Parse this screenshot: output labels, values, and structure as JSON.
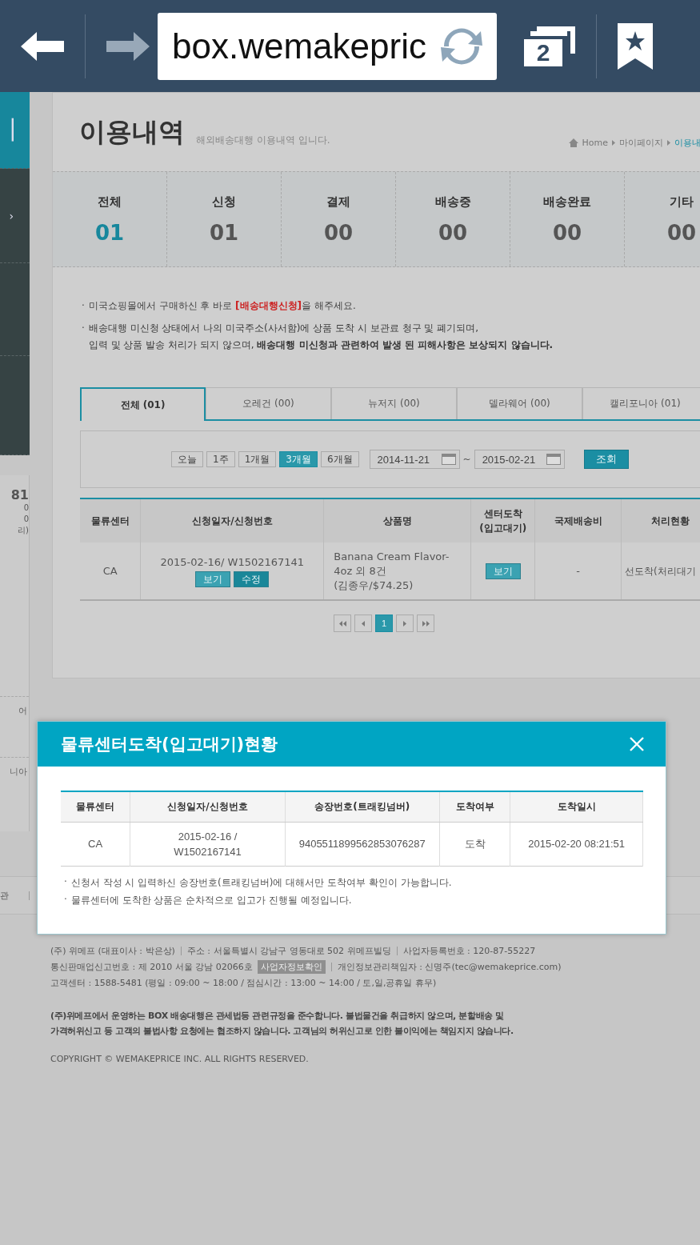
{
  "browser": {
    "url": "box.wemakepric",
    "tab_count": "2"
  },
  "sidebar": {
    "menu": [
      {
        "label": "ㅣ",
        "selected": true
      },
      {
        "label": "›",
        "selected": false
      },
      {
        "selected": false
      },
      {
        "selected": false
      }
    ],
    "fragments": [
      "81",
      "0",
      "0",
      "리)"
    ],
    "lower_fragments": [
      "어",
      "니아"
    ],
    "footer_fragment": "관"
  },
  "header": {
    "title": "이용내역",
    "subtitle": "해외배송대행 이용내역 입니다.",
    "breadcrumb": [
      {
        "label": "Home",
        "current": false
      },
      {
        "label": "마이페이지",
        "current": false
      },
      {
        "label": "이용내",
        "current": true
      }
    ]
  },
  "stats": [
    {
      "label": "전체",
      "value": "01",
      "selected": true
    },
    {
      "label": "신청",
      "value": "01",
      "selected": false
    },
    {
      "label": "결제",
      "value": "00",
      "selected": false
    },
    {
      "label": "배송중",
      "value": "00",
      "selected": false
    },
    {
      "label": "배송완료",
      "value": "00",
      "selected": false
    },
    {
      "label": "기타",
      "value": "00",
      "selected": false
    }
  ],
  "notices": [
    {
      "bullet": "·",
      "text": "미국쇼핑몰에서 구매하신 후 바로 **[배송대행신청]**을 해주세요.",
      "highlighted": true
    },
    {
      "bullet": "·",
      "text": "배송대행 미신청 상태에서 나의 미국주소(사서함)에 상품 도착 시 보관료 청구 및 폐기되며,\n입력 및 상품 발송 처리가 되지 않으며, **배송대행 미신청과 관련하여 발생 된 피해사항은 보상되지 않습니다.**",
      "highlighted": false
    }
  ],
  "region_tabs": [
    {
      "label": "전체 (01)",
      "selected": true
    },
    {
      "label": "오레건 (00)",
      "selected": false
    },
    {
      "label": "뉴저지 (00)",
      "selected": false
    },
    {
      "label": "델라웨어 (00)",
      "selected": false
    },
    {
      "label": "캘리포니아 (01)",
      "selected": false
    }
  ],
  "filter": {
    "periods": [
      {
        "label": "오늘",
        "selected": false
      },
      {
        "label": "1주",
        "selected": false
      },
      {
        "label": "1개월",
        "selected": false
      },
      {
        "label": "3개월",
        "selected": true
      },
      {
        "label": "6개월",
        "selected": false
      }
    ],
    "date_from": "2014-11-21",
    "separator": "~",
    "date_to": "2015-02-21",
    "search_button": "조회"
  },
  "table": {
    "columns": [
      "물류센터",
      "신청일자/신청번호",
      "상품명",
      "센터도착\n(입고대기)",
      "국제배송비",
      "처리현황"
    ],
    "rows": [
      {
        "center": "CA",
        "request": "2015-02-16/ W1502167141",
        "actions": [
          {
            "label": "보기",
            "kind": "light"
          },
          {
            "label": "수정",
            "kind": "dark"
          }
        ],
        "product": [
          "Banana Cream Flavor-",
          "4oz 외 8건",
          "(김종우/$74.25)"
        ],
        "arrival_button": "보기",
        "fee": "-",
        "status": "선도착(처리대기"
      }
    ]
  },
  "pagination": {
    "pages": [
      {
        "label": "1",
        "selected": true
      }
    ]
  },
  "modal": {
    "title": "물류센터도착(입고대기)현황",
    "columns": [
      "물류센터",
      "신청일자/신청번호",
      "송장번호(트래킹넘버)",
      "도착여부",
      "도착일시"
    ],
    "rows": [
      {
        "center": "CA",
        "request": "2015-02-16 /\nW1502167141",
        "tracking": "9405511899562853076287",
        "arrived": "도착",
        "arrived_at": "2015-02-20 08:21:51"
      }
    ],
    "notes": [
      {
        "bullet": "·",
        "text": "신청서 작성 시 입력하신 송장번호(트래킹넘버)에 대해서만 도착여부 확인이 가능합니다."
      },
      {
        "bullet": "·",
        "text": "물류센터에 도착한 상품은 순차적으로 입고가 진행될 예정입니다."
      }
    ]
  },
  "footer": {
    "company_lines": [
      [
        "(주) 위메프 (대표이사 : 박은상)",
        "주소 : 서울특별시 강남구 영동대로 502 위메프빌딩",
        "사업자등록번호 : 120-87-55227"
      ],
      [
        "통신판매업신고번호 : 제 2010 서울 강남 02066호"
      ],
      [
        "고객센터 : 1588-5481 (평일 : 09:00 ~ 18:00 / 점심시간 : 13:00 ~ 14:00 / 토,일,공휴일 휴무)"
      ]
    ],
    "info_button": "사업자정보확인",
    "privacy": "개인정보관리책임자 : 신명주(tec@wemakeprice.com)",
    "legal": "(주)위메프에서 운영하는 BOX 배송대행은 관세법등 관련규정을 준수합니다. 불법물건을 취급하지 않으며, 분할배송 및\n가격허위신고 등 고객의 불법사항 요청에는 협조하지 않습니다. 고객님의 허위신고로 인한 불이익에는 책임지지 않습니다.",
    "copyright": "COPYRIGHT © WEMAKEPRICE INC. ALL RIGHTS RESERVED."
  }
}
